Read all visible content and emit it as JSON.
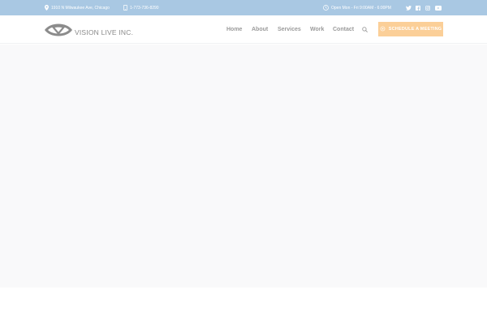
{
  "topbar": {
    "address": "1910 N Milwaukee Ave, Chicago",
    "phone": "1-773-736-8290",
    "hours": "Open Mon - Fri 9:00AM - 6:00PM",
    "social": [
      "twitter-icon",
      "facebook-icon",
      "instagram-icon",
      "youtube-icon"
    ]
  },
  "header": {
    "logo_text": "VISION LIVE INC.",
    "nav": {
      "home": "Home",
      "about": "About",
      "services": "Services",
      "work": "Work",
      "contact": "Contact"
    },
    "cta_label": "SCHEDULE A MEETING"
  },
  "colors": {
    "topbar_bg": "#a9c8e3",
    "cta_bg": "#fbcf98",
    "hero_bg": "#f9f9fa",
    "nav_text": "#9a9a9a"
  }
}
